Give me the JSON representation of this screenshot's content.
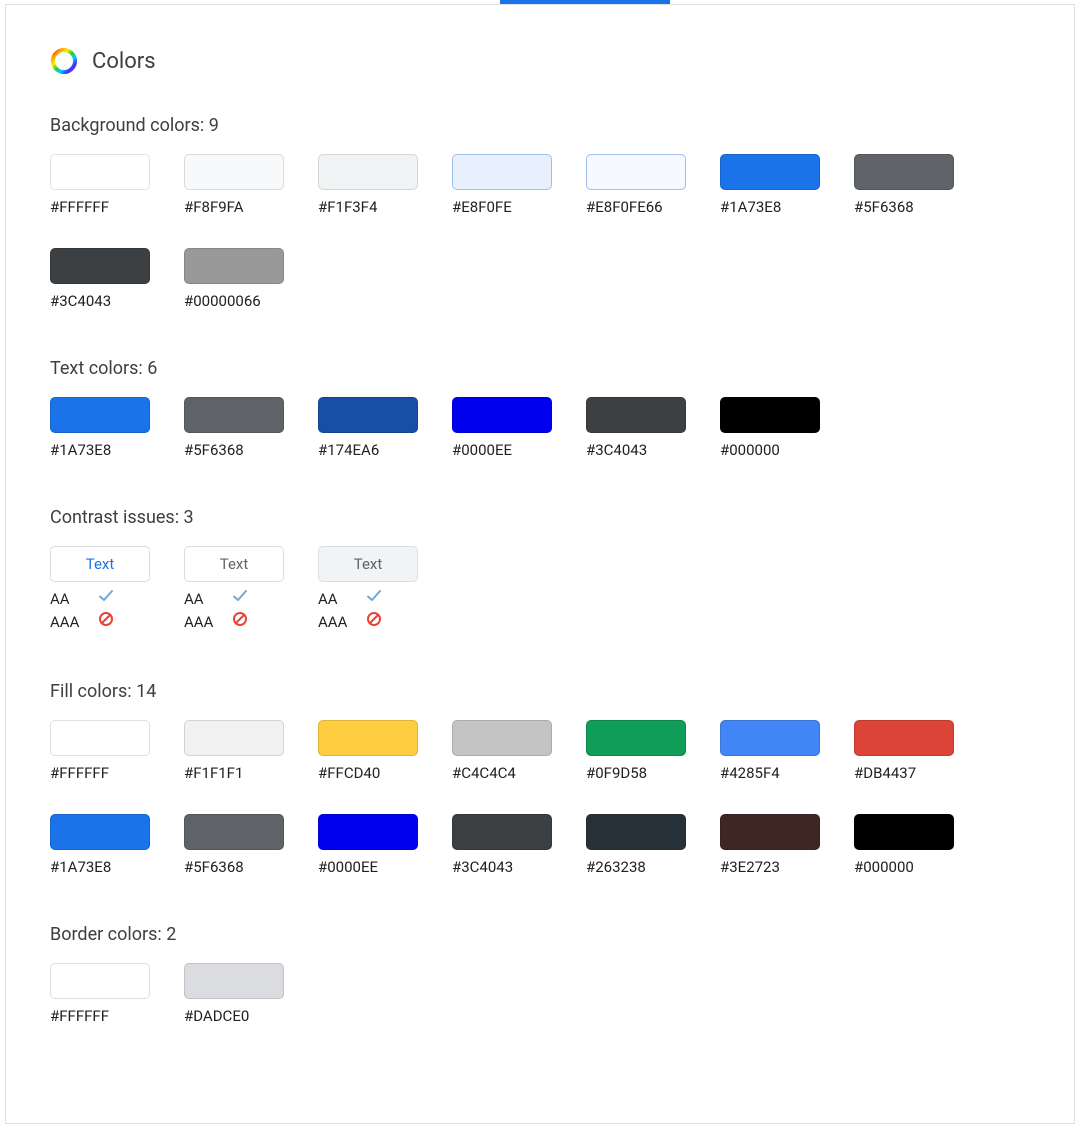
{
  "header": {
    "title": "Colors"
  },
  "sections": {
    "background": {
      "title": "Background colors: 9",
      "swatches": [
        {
          "label": "#FFFFFF",
          "color": "#FFFFFF"
        },
        {
          "label": "#F8F9FA",
          "color": "#F8F9FA"
        },
        {
          "label": "#F1F3F4",
          "color": "#F1F3F4"
        },
        {
          "label": "#E8F0FE",
          "color": "#E8F0FE",
          "border": "#9fc0ef"
        },
        {
          "label": "#E8F0FE66",
          "color": "#E8F0FE66",
          "border": "#9fc0ef"
        },
        {
          "label": "#1A73E8",
          "color": "#1A73E8"
        },
        {
          "label": "#5F6368",
          "color": "#5F6368"
        },
        {
          "label": "#3C4043",
          "color": "#3C4043"
        },
        {
          "label": "#00000066",
          "color": "#00000066"
        }
      ]
    },
    "text": {
      "title": "Text colors: 6",
      "swatches": [
        {
          "label": "#1A73E8",
          "color": "#1A73E8"
        },
        {
          "label": "#5F6368",
          "color": "#5F6368"
        },
        {
          "label": "#174EA6",
          "color": "#174EA6"
        },
        {
          "label": "#0000EE",
          "color": "#0000EE"
        },
        {
          "label": "#3C4043",
          "color": "#3C4043"
        },
        {
          "label": "#000000",
          "color": "#000000"
        }
      ]
    },
    "contrast": {
      "title": "Contrast issues: 3",
      "sampleText": "Text",
      "levels": {
        "aa": "AA",
        "aaa": "AAA"
      },
      "items": [
        {
          "bg": "#FFFFFF",
          "fg": "#1A73E8",
          "aa": "pass",
          "aaa": "fail"
        },
        {
          "bg": "#FFFFFF",
          "fg": "#5F6368",
          "aa": "pass",
          "aaa": "fail"
        },
        {
          "bg": "#F1F3F4",
          "fg": "#5F6368",
          "aa": "pass",
          "aaa": "fail"
        }
      ]
    },
    "fill": {
      "title": "Fill colors: 14",
      "swatches": [
        {
          "label": "#FFFFFF",
          "color": "#FFFFFF"
        },
        {
          "label": "#F1F1F1",
          "color": "#F1F1F1"
        },
        {
          "label": "#FFCD40",
          "color": "#FFCD40"
        },
        {
          "label": "#C4C4C4",
          "color": "#C4C4C4"
        },
        {
          "label": "#0F9D58",
          "color": "#0F9D58"
        },
        {
          "label": "#4285F4",
          "color": "#4285F4"
        },
        {
          "label": "#DB4437",
          "color": "#DB4437"
        },
        {
          "label": "#1A73E8",
          "color": "#1A73E8"
        },
        {
          "label": "#5F6368",
          "color": "#5F6368"
        },
        {
          "label": "#0000EE",
          "color": "#0000EE"
        },
        {
          "label": "#3C4043",
          "color": "#3C4043"
        },
        {
          "label": "#263238",
          "color": "#263238"
        },
        {
          "label": "#3E2723",
          "color": "#3E2723"
        },
        {
          "label": "#000000",
          "color": "#000000"
        }
      ]
    },
    "border": {
      "title": "Border colors: 2",
      "swatches": [
        {
          "label": "#FFFFFF",
          "color": "#FFFFFF"
        },
        {
          "label": "#DADCE0",
          "color": "#DADCE0"
        }
      ]
    }
  }
}
